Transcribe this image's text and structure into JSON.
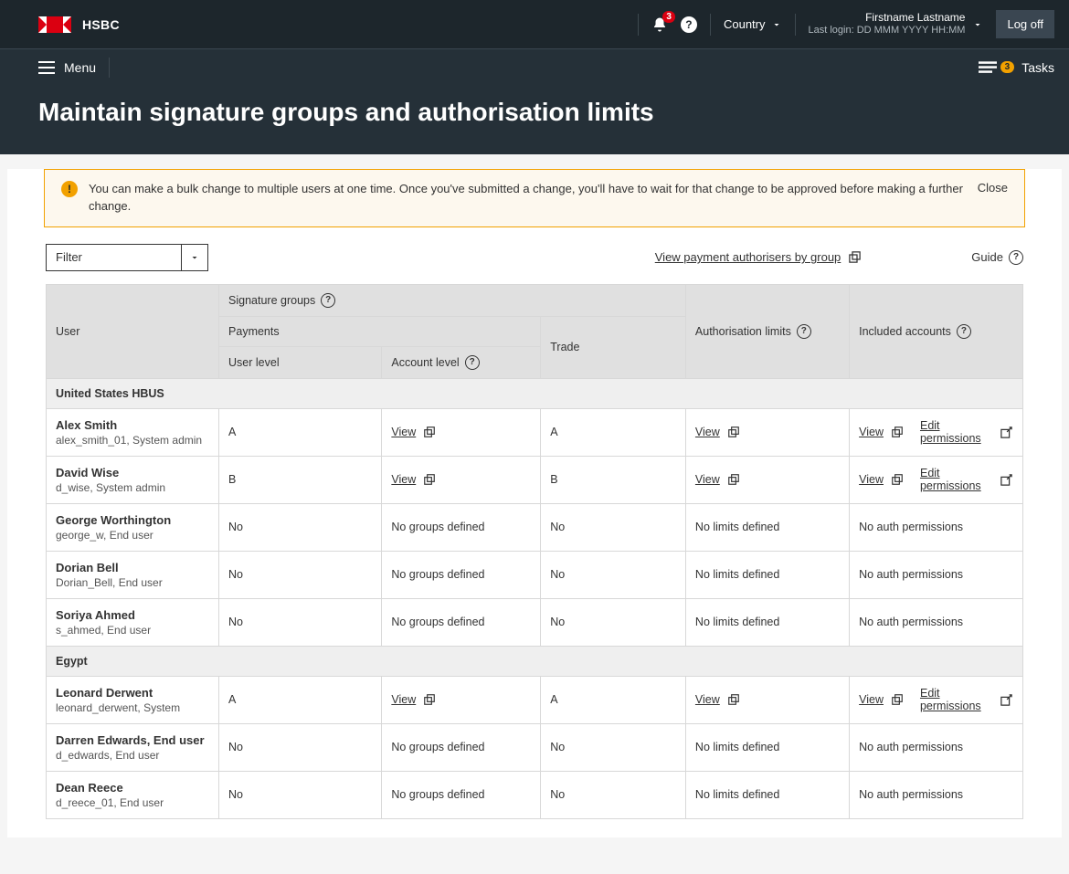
{
  "header": {
    "bank_name": "HSBC",
    "notif_count": "3",
    "country_label": "Country",
    "user_name": "Firstname Lastname",
    "last_login": "Last login: DD MMM YYYY HH:MM",
    "logoff": "Log off"
  },
  "subheader": {
    "menu": "Menu",
    "tasks_label": "Tasks",
    "tasks_count": "3"
  },
  "page_title": "Maintain signature groups and authorisation limits",
  "notice": {
    "message": "You can make a bulk change to multiple users at one time.  Once you've submitted a change, you'll have to wait for that change to be approved before making a further change.",
    "close": "Close"
  },
  "controls": {
    "filter": "Filter",
    "view_authorisers": "View payment authorisers by group",
    "guide": "Guide"
  },
  "columns": {
    "user": "User",
    "sig_groups": "Signature groups",
    "payments": "Payments",
    "user_level": "User level",
    "account_level": "Account level",
    "trade": "Trade",
    "auth_limits": "Authorisation limits",
    "included_accounts": "Included accounts"
  },
  "labels": {
    "view": "View",
    "edit_permissions": "Edit permissions",
    "no_groups": "No groups defined",
    "no_limits": "No limits defined",
    "no_auth": "No auth permissions",
    "no": "No"
  },
  "groups": [
    {
      "name": "United States HBUS",
      "rows": [
        {
          "name": "Alex Smith",
          "sub": "alex_smith_01, System admin",
          "ul": "A",
          "al": "view",
          "trade": "A",
          "limits": "view",
          "acct": "edit"
        },
        {
          "name": "David Wise",
          "sub": "d_wise, System admin",
          "ul": "B",
          "al": "view",
          "trade": "B",
          "limits": "view",
          "acct": "edit"
        },
        {
          "name": "George Worthington",
          "sub": "george_w, End user",
          "ul": "No",
          "al": "nogroups",
          "trade": "No",
          "limits": "nolimits",
          "acct": "noauth"
        },
        {
          "name": "Dorian Bell",
          "sub": "Dorian_Bell, End user",
          "ul": "No",
          "al": "nogroups",
          "trade": "No",
          "limits": "nolimits",
          "acct": "noauth"
        },
        {
          "name": "Soriya Ahmed",
          "sub": "s_ahmed, End user",
          "ul": "No",
          "al": "nogroups",
          "trade": "No",
          "limits": "nolimits",
          "acct": "noauth"
        }
      ]
    },
    {
      "name": "Egypt",
      "rows": [
        {
          "name": "Leonard Derwent",
          "sub": "leonard_derwent, System",
          "ul": "A",
          "al": "view",
          "trade": "A",
          "limits": "view",
          "acct": "edit"
        },
        {
          "name": "Darren Edwards, End user",
          "sub": "d_edwards, End user",
          "ul": "No",
          "al": "nogroups",
          "trade": "No",
          "limits": "nolimits",
          "acct": "noauth"
        },
        {
          "name": "Dean Reece",
          "sub": "d_reece_01, End user",
          "ul": "No",
          "al": "nogroups",
          "trade": "No",
          "limits": "nolimits",
          "acct": "noauth"
        }
      ]
    }
  ]
}
